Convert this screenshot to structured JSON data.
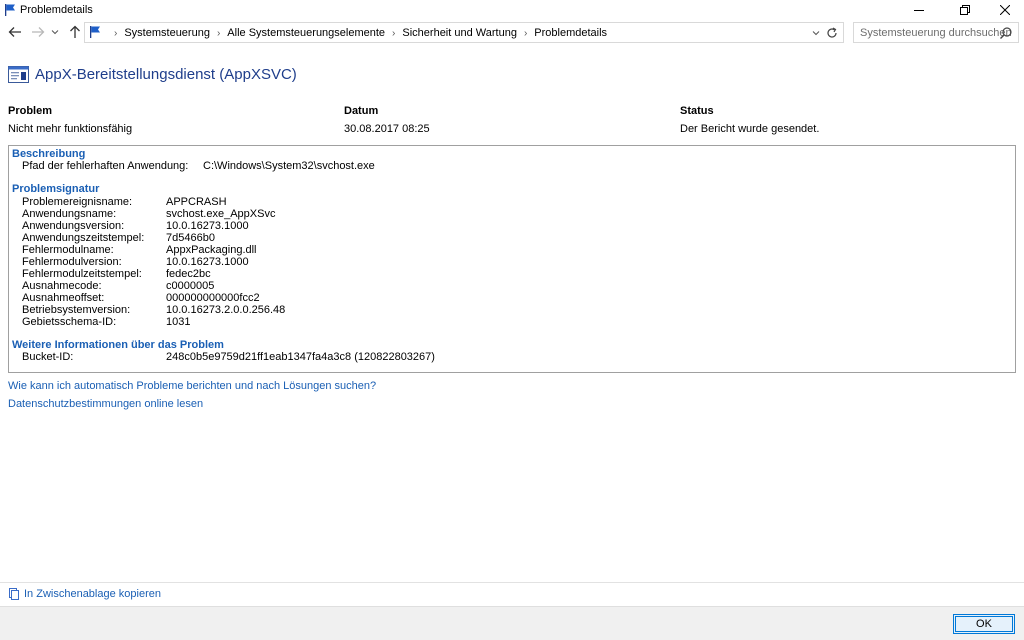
{
  "window": {
    "title": "Problemdetails"
  },
  "nav": {
    "breadcrumbs": [
      "Systemsteuerung",
      "Alle Systemsteuerungselemente",
      "Sicherheit und Wartung",
      "Problemdetails"
    ],
    "search_placeholder": "Systemsteuerung durchsuchen"
  },
  "header": {
    "title": "AppX-Bereitstellungsdienst (AppXSVC)"
  },
  "summary": {
    "problem_label": "Problem",
    "problem_value": "Nicht mehr funktionsfähig",
    "date_label": "Datum",
    "date_value": "30.08.2017 08:25",
    "status_label": "Status",
    "status_value": "Der Bericht wurde gesendet."
  },
  "details": {
    "description_heading": "Beschreibung",
    "description_rows": [
      {
        "key": "Pfad der fehlerhaften Anwendung:",
        "value": "C:\\Windows\\System32\\svchost.exe"
      }
    ],
    "signature_heading": "Problemsignatur",
    "signature_rows": [
      {
        "key": "Problemereignisname:",
        "value": "APPCRASH"
      },
      {
        "key": "Anwendungsname:",
        "value": "svchost.exe_AppXSvc"
      },
      {
        "key": "Anwendungsversion:",
        "value": "10.0.16273.1000"
      },
      {
        "key": "Anwendungszeitstempel:",
        "value": "7d5466b0"
      },
      {
        "key": "Fehlermodulname:",
        "value": "AppxPackaging.dll"
      },
      {
        "key": "Fehlermodulversion:",
        "value": "10.0.16273.1000"
      },
      {
        "key": "Fehlermodulzeitstempel:",
        "value": "fedec2bc"
      },
      {
        "key": "Ausnahmecode:",
        "value": "c0000005"
      },
      {
        "key": "Ausnahmeoffset:",
        "value": "000000000000fcc2"
      },
      {
        "key": "Betriebsystemversion:",
        "value": "10.0.16273.2.0.0.256.48"
      },
      {
        "key": "Gebietsschema-ID:",
        "value": "1031"
      }
    ],
    "more_heading": "Weitere Informationen über das Problem",
    "more_rows": [
      {
        "key": "Bucket-ID:",
        "value": "248c0b5e9759d21ff1eab1347fa4a3c8 (120822803267)"
      }
    ]
  },
  "links": {
    "auto_report": "Wie kann ich automatisch Probleme berichten und nach Lösungen suchen?",
    "privacy": "Datenschutzbestimmungen online lesen",
    "copy_clipboard": "In Zwischenablage kopieren"
  },
  "footer": {
    "ok_label": "OK"
  },
  "colors": {
    "link_blue": "#1a5fb4",
    "title_blue": "#1f3e8b",
    "button_border": "#0078d7"
  }
}
